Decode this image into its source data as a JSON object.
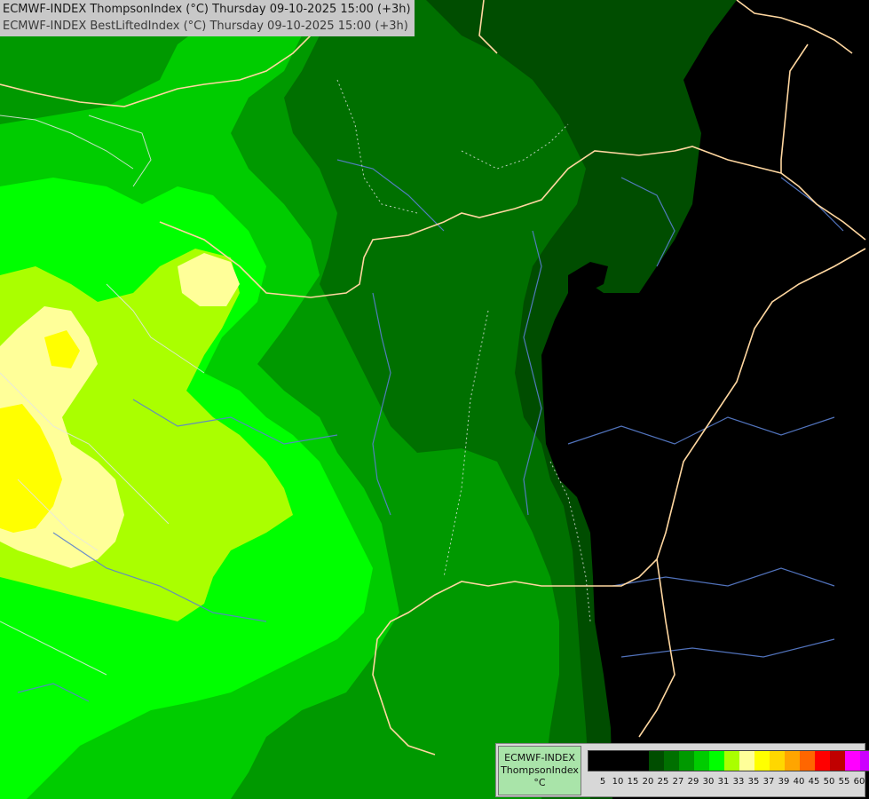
{
  "titles": {
    "line1": "ECMWF-INDEX ThompsonIndex (°C) Thursday 09-10-2025 15:00 (+3h)",
    "line2": "ECMWF-INDEX BestLiftedIndex (°C) Thursday 09-10-2025 15:00 (+3h)"
  },
  "legend": {
    "model": "ECMWF-INDEX",
    "parameter": "ThompsonIndex",
    "unit": "°C",
    "colors": [
      "#000000",
      "#000000",
      "#000000",
      "#000000",
      "#004d00",
      "#007000",
      "#009900",
      "#00cc00",
      "#00ff00",
      "#aaff00",
      "#ffff99",
      "#ffff00",
      "#ffd700",
      "#ffa500",
      "#ff6600",
      "#ff0000",
      "#c00000",
      "#ff00ff",
      "#cc00ff",
      "#8000ff",
      "#0000ff"
    ],
    "ticks": [
      "5",
      "10",
      "15",
      "20",
      "25",
      "27",
      "29",
      "30",
      "31",
      "33",
      "35",
      "37",
      "39",
      "40",
      "45",
      "50",
      "55",
      "60"
    ]
  },
  "map_colors": {
    "background": "#000000",
    "dark_green": "#004d00",
    "green_2": "#007000",
    "green_3": "#009900",
    "green_4": "#00cc00",
    "bright_green": "#00ff00",
    "lime": "#aaff00",
    "pale_yellow": "#ffff99",
    "yellow": "#ffff00",
    "border": "#ffd7a0",
    "river": "#5a7fd0",
    "region": "#e6e6e6"
  }
}
